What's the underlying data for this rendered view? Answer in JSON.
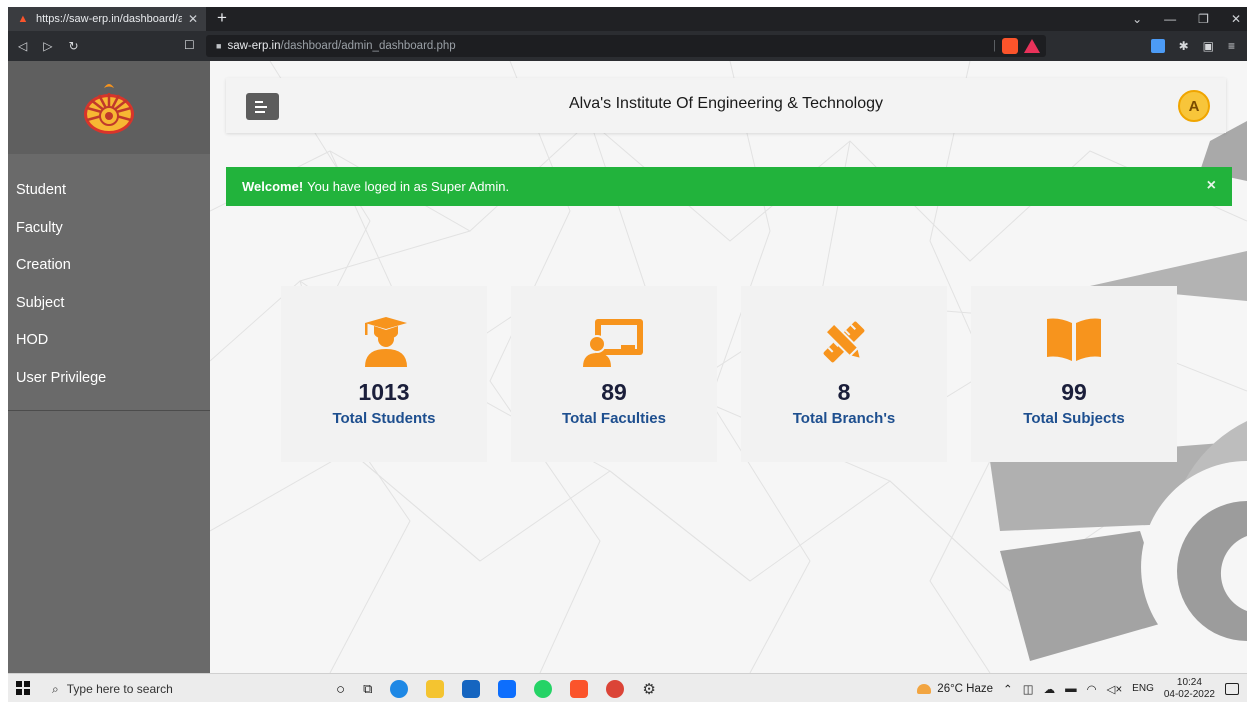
{
  "browser": {
    "tab_title": "https://saw-erp.in/dashboard/adr",
    "url_host": "saw-erp.in",
    "url_path": "/dashboard/admin_dashboard.php"
  },
  "header": {
    "institute_name": "Alva's Institute Of Engineering & Technology",
    "avatar_letter": "A"
  },
  "sidebar": {
    "items": [
      {
        "label": "Student"
      },
      {
        "label": "Faculty"
      },
      {
        "label": "Creation"
      },
      {
        "label": "Subject"
      },
      {
        "label": "HOD"
      },
      {
        "label": "User Privilege"
      }
    ]
  },
  "alert": {
    "strong": "Welcome!",
    "message": "You have loged in as Super Admin.",
    "close": "×"
  },
  "stats": [
    {
      "value": "1013",
      "label": "Total Students",
      "icon": "student-icon"
    },
    {
      "value": "89",
      "label": "Total Faculties",
      "icon": "teacher-icon"
    },
    {
      "value": "8",
      "label": "Total Branch's",
      "icon": "pencil-ruler-icon"
    },
    {
      "value": "99",
      "label": "Total Subjects",
      "icon": "book-icon"
    }
  ],
  "colors": {
    "accent_orange": "#f7941d",
    "alert_green": "#22b33c",
    "sidebar_gray": "#6a6a6a",
    "stat_number": "#1b1f3b",
    "stat_label": "#1e4f8f"
  },
  "taskbar": {
    "search_placeholder": "Type here to search",
    "weather": "26°C  Haze",
    "language": "ENG",
    "time": "10:24",
    "date": "04-02-2022"
  }
}
